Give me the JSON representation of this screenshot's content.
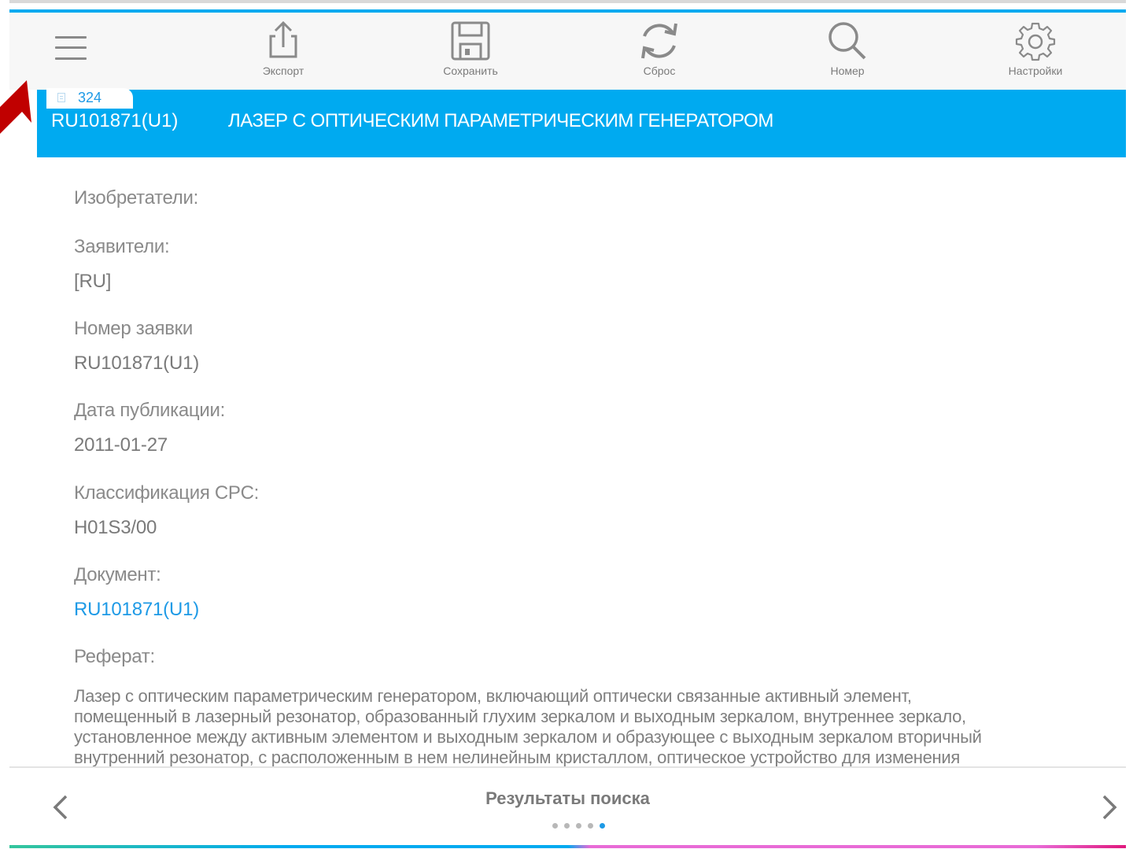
{
  "toolbar": {
    "menu_icon": "hamburger-menu-icon",
    "items": [
      {
        "id": "export",
        "label": "Экспорт",
        "icon": "share-export-icon"
      },
      {
        "id": "save",
        "label": "Сохранить",
        "icon": "floppy-save-icon"
      },
      {
        "id": "reset",
        "label": "Сброс",
        "icon": "refresh-icon"
      },
      {
        "id": "number",
        "label": "Номер",
        "icon": "search-icon"
      },
      {
        "id": "settings",
        "label": "Настройки",
        "icon": "gear-icon"
      }
    ]
  },
  "header": {
    "count": "324",
    "doc_id": "RU101871(U1)",
    "title": "ЛАЗЕР С ОПТИЧЕСКИМ ПАРАМЕТРИЧЕСКИМ ГЕНЕРАТОРОМ"
  },
  "fields": {
    "inventors_label": "Изобретатели:",
    "applicants_label": "Заявители:",
    "applicants_value": "[RU]",
    "app_number_label": "Номер заявки",
    "app_number_value": "RU101871(U1)",
    "pub_date_label": "Дата публикации:",
    "pub_date_value": "2011-01-27",
    "cpc_label": "Классификация CPC:",
    "cpc_value": "H01S3/00",
    "document_label": "Документ:",
    "document_value": "RU101871(U1)",
    "abstract_label": "Реферат:",
    "abstract_lines": [
      "Лазер с оптическим параметрическим генератором, включающий оптически связанные активный элемент,",
      "помещенный в лазерный резонатор, образованный глухим зеркалом и выходным зеркалом, внутреннее зеркало,",
      "установленное между активным элементом и выходным зеркалом и образующее с выходным зеркалом вторичный",
      "внутренний резонатор, с расположенным в нем нелинейным кристаллом, оптическое устройство для изменения"
    ]
  },
  "bottom": {
    "title": "Результаты поиска",
    "prev_icon": "chevron-left-icon",
    "next_icon": "chevron-right-icon",
    "pages": 5,
    "active_page": 5
  },
  "colors": {
    "accent": "#00aaf0",
    "link": "#1e9ae6",
    "annotation_arrow": "#c00000"
  }
}
